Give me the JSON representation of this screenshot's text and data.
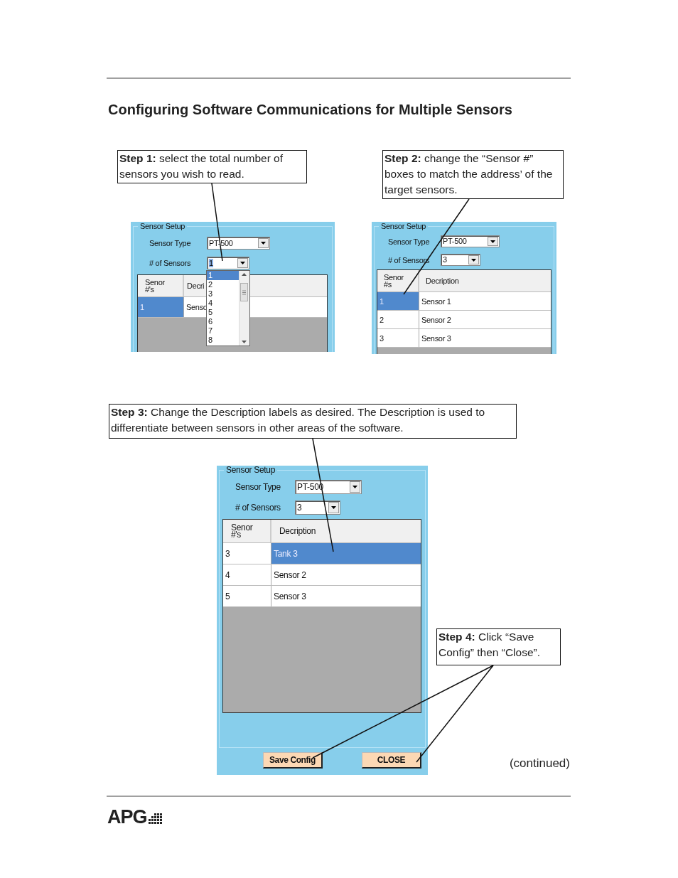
{
  "title": "Configuring Software Communications for Multiple Sensors",
  "callouts": [
    {
      "text": "**Step 1:** select the total number of sensors you wish to read."
    },
    {
      "text": "**Step 2:** change the “Sensor #” boxes to match the address’ of the target sensors."
    },
    {
      "text": "**Step 3:** Change the Description labels as desired.  The Description is used to differentiate between sensors in other areas of the software."
    },
    {
      "text": "**Step 4:** Click “Save Config” then “Close”."
    }
  ],
  "panels": [
    {
      "group_title": "Sensor Setup",
      "fields": [
        {
          "label": "Sensor Type",
          "value": "PT-500",
          "text_selected": false
        },
        {
          "label": "# of Sensors",
          "value": "1",
          "text_selected": true
        }
      ],
      "columns": [
        "Senor #'s",
        "Decri"
      ],
      "rows": [
        {
          "cells": [
            {
              "text": "1",
              "selected": true
            },
            {
              "text": "Senso",
              "selected": false
            }
          ]
        }
      ],
      "dropdown": {
        "items": [
          {
            "label": "1",
            "selected": true
          },
          {
            "label": "2",
            "selected": false
          },
          {
            "label": "3",
            "selected": false
          },
          {
            "label": "4",
            "selected": false
          },
          {
            "label": "5",
            "selected": false
          },
          {
            "label": "6",
            "selected": false
          },
          {
            "label": "7",
            "selected": false
          },
          {
            "label": "8",
            "selected": false
          }
        ]
      }
    },
    {
      "group_title": "Sensor Setup",
      "fields": [
        {
          "label": "Sensor Type",
          "value": "PT-500",
          "text_selected": false
        },
        {
          "label": "# of Sensors",
          "value": "3",
          "text_selected": false
        }
      ],
      "columns": [
        "Senor #s",
        "Decription"
      ],
      "rows": [
        {
          "cells": [
            {
              "text": "1",
              "selected": true
            },
            {
              "text": "Sensor 1",
              "selected": false
            }
          ]
        },
        {
          "cells": [
            {
              "text": "2",
              "selected": false
            },
            {
              "text": "Sensor 2",
              "selected": false
            }
          ]
        },
        {
          "cells": [
            {
              "text": "3",
              "selected": false
            },
            {
              "text": "Sensor 3",
              "selected": false
            }
          ]
        }
      ]
    },
    {
      "group_title": "Sensor Setup",
      "fields": [
        {
          "label": "Sensor Type",
          "value": "PT-500",
          "text_selected": false
        },
        {
          "label": "# of Sensors",
          "value": "3",
          "text_selected": false
        }
      ],
      "columns": [
        "Senor #'s",
        "Decription"
      ],
      "rows": [
        {
          "cells": [
            {
              "text": "3",
              "selected": false
            },
            {
              "text": "Tank 3",
              "selected": true
            }
          ]
        },
        {
          "cells": [
            {
              "text": "4",
              "selected": false
            },
            {
              "text": "Sensor 2",
              "selected": false
            }
          ]
        },
        {
          "cells": [
            {
              "text": "5",
              "selected": false
            },
            {
              "text": "Sensor 3",
              "selected": false
            }
          ]
        }
      ],
      "buttons": [
        {
          "label": "Save Config"
        },
        {
          "label": "CLOSE"
        }
      ]
    }
  ],
  "continued": "(continued)",
  "logo": "APG"
}
